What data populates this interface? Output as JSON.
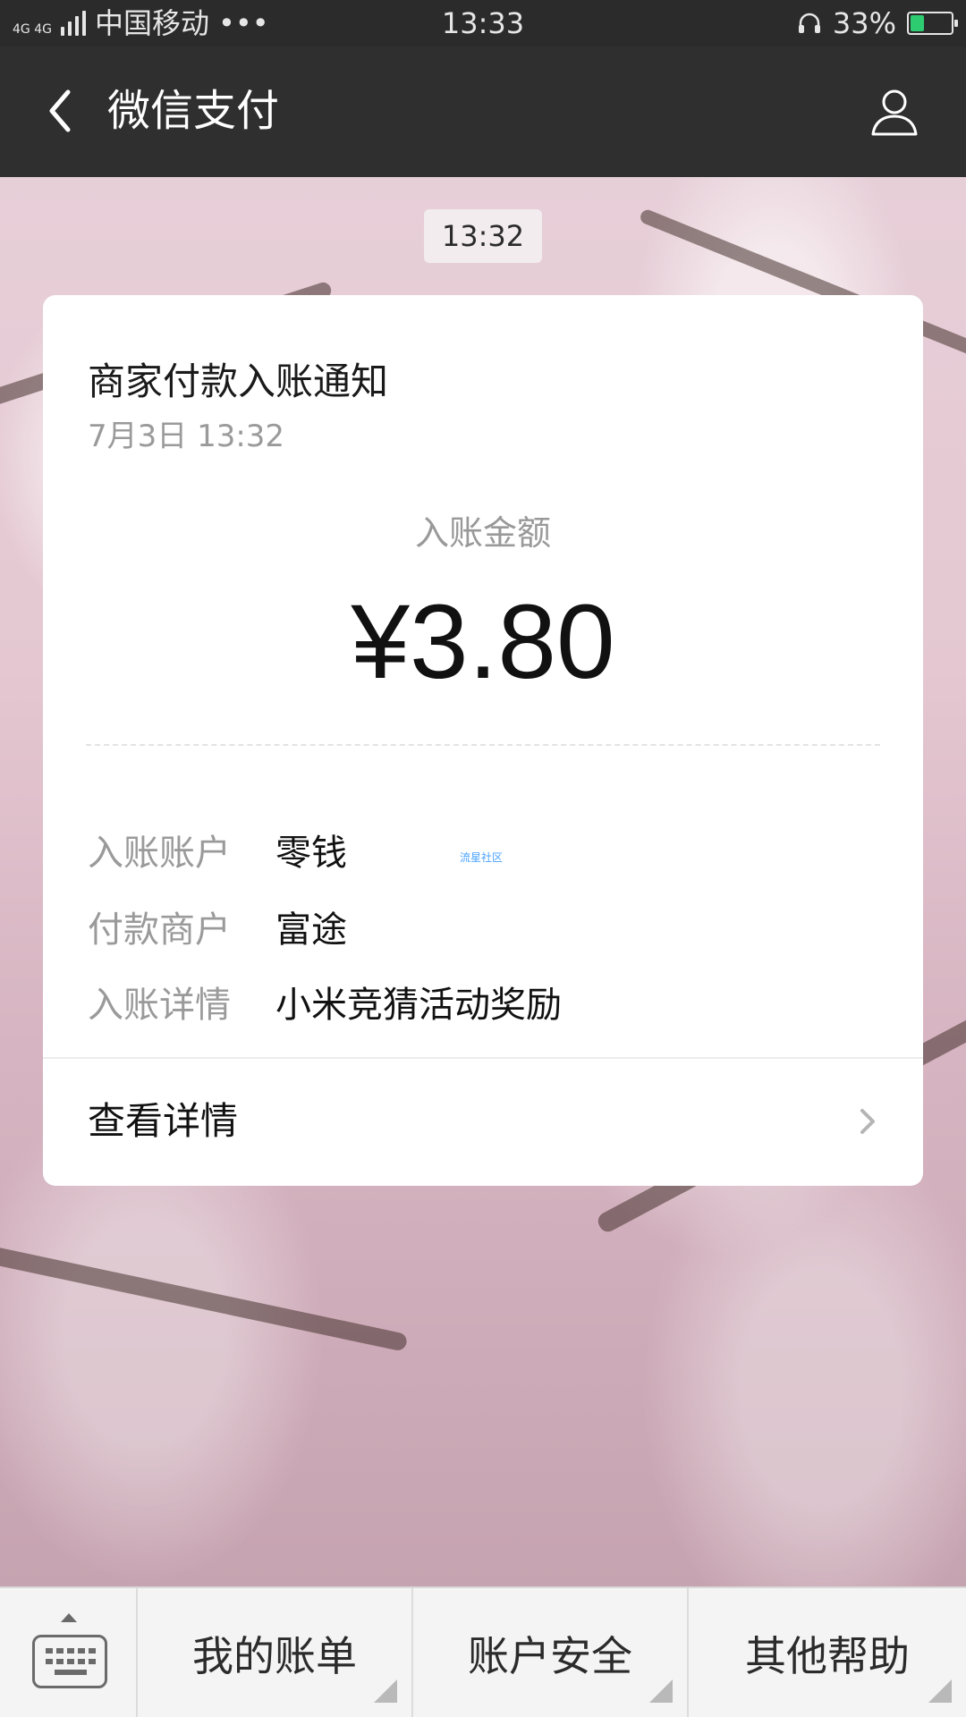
{
  "status_bar": {
    "network": "4G 4G",
    "carrier": "中国移动",
    "more": "•••",
    "time": "13:33",
    "battery_percent": "33%",
    "battery_level": 0.33
  },
  "nav": {
    "back_icon": "chevron-left-icon",
    "title": "微信支付",
    "profile_icon": "user-icon"
  },
  "message": {
    "time": "13:32"
  },
  "card": {
    "title": "商家付款入账通知",
    "date": "7月3日  13:32",
    "amount_label": "入账金额",
    "amount": "¥3.80",
    "rows": [
      {
        "label": "入账账户",
        "value": "零钱"
      },
      {
        "label": "付款商户",
        "value": "富途"
      },
      {
        "label": "入账详情",
        "value": "小米竞猜活动奖励"
      }
    ],
    "watermark": "流星社区",
    "view_details": "查看详情"
  },
  "bottom_menu": {
    "keyboard_icon": "keyboard-icon",
    "items": [
      {
        "label": "我的账单"
      },
      {
        "label": "账户安全"
      },
      {
        "label": "其他帮助"
      }
    ]
  },
  "colors": {
    "status_bar_bg": "#2b2b2b",
    "nav_bg": "#2f2f2f",
    "battery_fill": "#2ecc71",
    "card_bg": "#ffffff",
    "bottom_bar_bg": "#f4f4f4"
  }
}
